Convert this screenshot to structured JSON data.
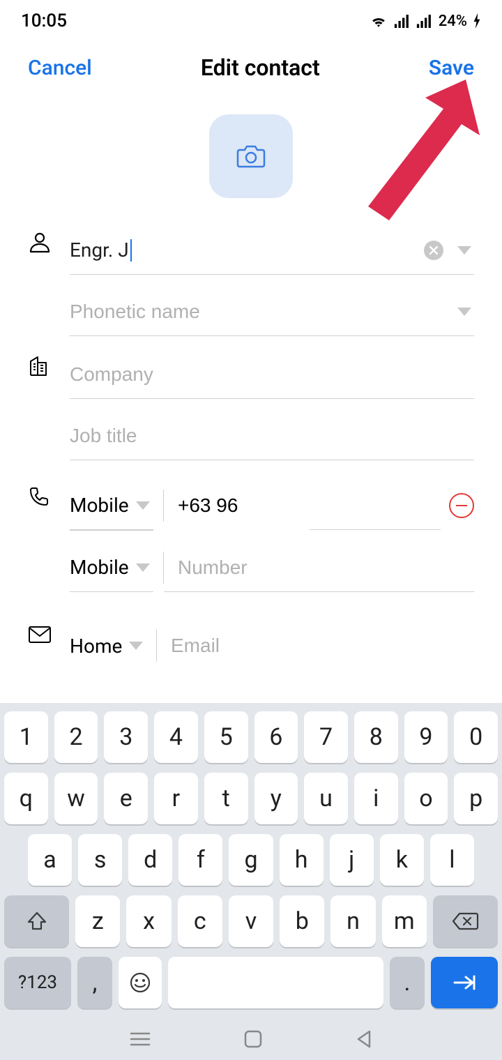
{
  "status": {
    "time": "10:05",
    "battery": "24%"
  },
  "header": {
    "cancel": "Cancel",
    "title": "Edit contact",
    "save": "Save"
  },
  "form": {
    "name_value": "Engr. J",
    "phonetic_placeholder": "Phonetic name",
    "company_placeholder": "Company",
    "jobtitle_placeholder": "Job title",
    "phone1_type": "Mobile",
    "phone1_value": "+63 96",
    "phone2_type": "Mobile",
    "phone2_placeholder": "Number",
    "email_type": "Home",
    "email_placeholder": "Email"
  },
  "keyboard": {
    "row1": [
      "1",
      "2",
      "3",
      "4",
      "5",
      "6",
      "7",
      "8",
      "9",
      "0"
    ],
    "row2": [
      "q",
      "w",
      "e",
      "r",
      "t",
      "y",
      "u",
      "i",
      "o",
      "p"
    ],
    "row3": [
      "a",
      "s",
      "d",
      "f",
      "g",
      "h",
      "j",
      "k",
      "l"
    ],
    "row4": [
      "z",
      "x",
      "c",
      "v",
      "b",
      "n",
      "m"
    ],
    "sym": "?123",
    "comma": ",",
    "period": "."
  }
}
